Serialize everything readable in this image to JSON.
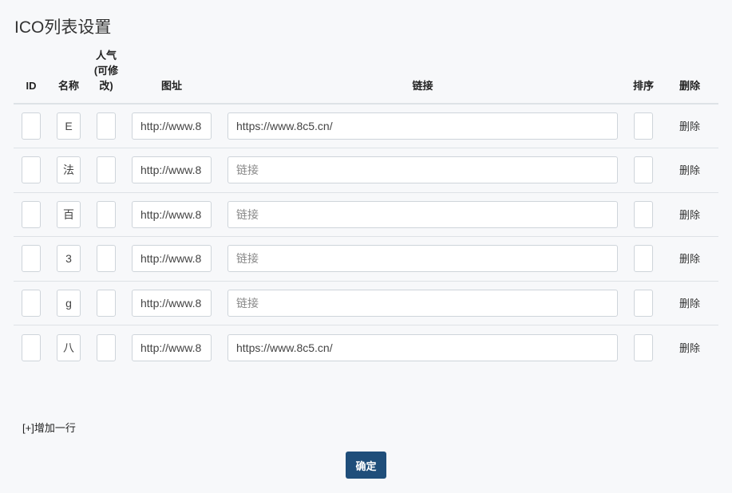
{
  "page": {
    "title": "ICO列表设置"
  },
  "table": {
    "headers": {
      "id": "ID",
      "name": "名称",
      "popularity": "人气(可修改)",
      "icon_url": "图址",
      "link": "链接",
      "sort": "排序",
      "delete": "删除"
    },
    "rows": [
      {
        "id": "",
        "name": "E",
        "popularity": "",
        "icon_url": "http://www.8",
        "link": "https://www.8c5.cn/",
        "link_placeholder": "链接",
        "sort": "",
        "delete_label": "删除"
      },
      {
        "id": "",
        "name": "法",
        "popularity": "",
        "icon_url": "http://www.8",
        "link": "",
        "link_placeholder": "链接",
        "sort": "",
        "delete_label": "删除"
      },
      {
        "id": "",
        "name": "百",
        "popularity": "",
        "icon_url": "http://www.8",
        "link": "",
        "link_placeholder": "链接",
        "sort": "",
        "delete_label": "删除"
      },
      {
        "id": "",
        "name": "3",
        "popularity": "",
        "icon_url": "http://www.8",
        "link": "",
        "link_placeholder": "链接",
        "sort": "",
        "delete_label": "删除"
      },
      {
        "id": "",
        "name": "g",
        "popularity": "",
        "icon_url": "http://www.8",
        "link": "",
        "link_placeholder": "链接",
        "sort": "",
        "delete_label": "删除"
      },
      {
        "id": "",
        "name": "八",
        "popularity": "",
        "icon_url": "http://www.8",
        "link": "https://www.8c5.cn/",
        "link_placeholder": "链接",
        "sort": "",
        "delete_label": "删除"
      }
    ]
  },
  "actions": {
    "add_row_label": "[+]增加一行",
    "confirm_label": "确定"
  }
}
